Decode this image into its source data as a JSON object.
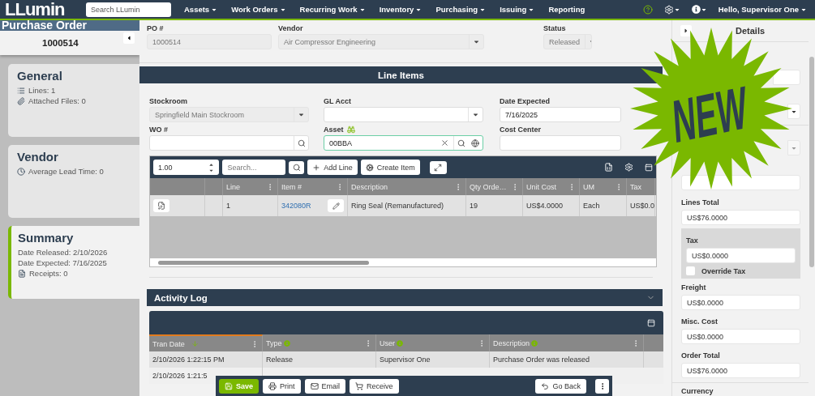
{
  "nav": {
    "logo": "LLumin",
    "search_placeholder": "Search LLumin",
    "menus": [
      {
        "label": "Assets",
        "has_caret": true
      },
      {
        "label": "Work Orders",
        "has_caret": true
      },
      {
        "label": "Recurring Work",
        "has_caret": true
      },
      {
        "label": "Inventory",
        "has_caret": true
      },
      {
        "label": "Purchasing",
        "has_caret": true
      },
      {
        "label": "Issuing",
        "has_caret": true
      },
      {
        "label": "Reporting",
        "has_caret": false
      }
    ],
    "user": "Hello, Supervisor One"
  },
  "sidebar": {
    "title": "Purchase Order",
    "number": "1000514",
    "cards": [
      {
        "title": "General",
        "accent": false,
        "lines": [
          "Lines: 1",
          "Attached Files: 0"
        ]
      },
      {
        "title": "Vendor",
        "accent": false,
        "lines": [
          "Average Lead Time: 0"
        ]
      },
      {
        "title": "Summary",
        "accent": true,
        "lines": [
          "Date Released: 2/10/2026",
          "Date Expected: 7/16/2025",
          "Receipts: 0"
        ]
      }
    ]
  },
  "header": {
    "fields": [
      {
        "label": "PO #",
        "value": "1000514",
        "kind": "text"
      },
      {
        "label": "Vendor",
        "value": "Air Compressor Engineering",
        "kind": "select"
      },
      {
        "label": "Status",
        "value": "Released",
        "kind": "select"
      }
    ]
  },
  "line_items": {
    "title": "Line Items",
    "fields": [
      {
        "label": "Stockroom",
        "value": "Springfield Main Stockroom",
        "kind": "select",
        "disabled": true
      },
      {
        "label": "GL Acct",
        "kind": "select",
        "disabled": false
      },
      {
        "label": "Date Expected",
        "value": "7/16/2025",
        "kind": "text",
        "disabled": false
      },
      {
        "label": "WO #",
        "kind": "lookup",
        "disabled": false
      },
      {
        "label": "Asset",
        "value": "00BBA",
        "kind": "asset",
        "disabled": false
      },
      {
        "label": "Cost Center",
        "kind": "text",
        "disabled": false
      }
    ],
    "toolbar": {
      "quantity": "1.00",
      "search_placeholder": "Search...",
      "buttons": [
        "Add Line",
        "Create Item"
      ]
    },
    "columns": [
      "Line",
      "Item #",
      "Description",
      "Qty Orde…",
      "Unit Cost",
      "UM",
      "Tax"
    ],
    "rows": [
      {
        "cells": [
          "1",
          "342080R",
          "Ring Seal (Remanufactured)",
          "19",
          "US$4.0000",
          "Each",
          "US$0.0"
        ]
      }
    ]
  },
  "activity_log": {
    "title": "Activity Log",
    "columns": [
      {
        "label": "Tran Date",
        "sorted": true,
        "info": false
      },
      {
        "label": "Type",
        "sorted": false,
        "info": true
      },
      {
        "label": "User",
        "sorted": false,
        "info": true
      },
      {
        "label": "Description",
        "sorted": false,
        "info": true
      }
    ],
    "rows": [
      [
        "2/10/2026 1:22:15 PM",
        "Release",
        "Supervisor One",
        "Purchase Order was released"
      ],
      [
        "2/10/2026 1:21:5"
      ]
    ]
  },
  "actions": [
    {
      "label": "Save",
      "primary": true
    },
    {
      "label": "Print",
      "primary": false
    },
    {
      "label": "Email",
      "primary": false
    },
    {
      "label": "Receive",
      "primary": false
    },
    {
      "label": "Go Back",
      "primary": false
    }
  ],
  "details": {
    "title": "Details",
    "totals": [
      {
        "label": "Lines Total",
        "value": "US$76.0000"
      }
    ],
    "tax": {
      "label": "Tax",
      "value": "US$0.0000",
      "override_label": "Override Tax",
      "override_checked": false
    },
    "costs": [
      {
        "label": "Freight",
        "value": "US$0.0000"
      },
      {
        "label": "Misc. Cost",
        "value": "US$0.0000"
      },
      {
        "label": "Order Total",
        "value": "US$76.0000"
      }
    ],
    "currency_label": "Currency"
  },
  "badge": {
    "text": "NEW"
  }
}
